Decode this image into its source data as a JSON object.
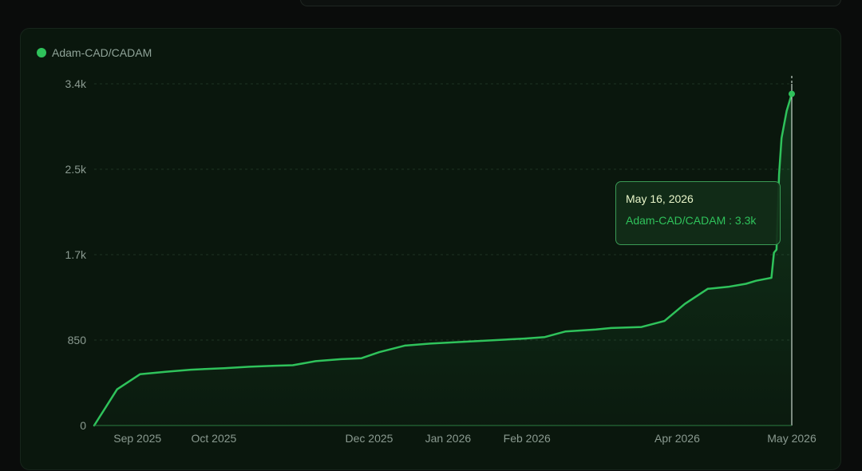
{
  "chart_data": {
    "type": "area",
    "series": [
      {
        "name": "Adam-CAD/CADAM",
        "color": "#2fc25b",
        "points": [
          {
            "x": "2025-08-15",
            "y": 0
          },
          {
            "x": "2025-08-24",
            "y": 360
          },
          {
            "x": "2025-09-02",
            "y": 510
          },
          {
            "x": "2025-09-12",
            "y": 535
          },
          {
            "x": "2025-09-22",
            "y": 555
          },
          {
            "x": "2025-10-05",
            "y": 570
          },
          {
            "x": "2025-10-15",
            "y": 585
          },
          {
            "x": "2025-10-25",
            "y": 595
          },
          {
            "x": "2025-11-01",
            "y": 600
          },
          {
            "x": "2025-11-10",
            "y": 640
          },
          {
            "x": "2025-11-20",
            "y": 660
          },
          {
            "x": "2025-11-28",
            "y": 670
          },
          {
            "x": "2025-12-05",
            "y": 730
          },
          {
            "x": "2025-12-15",
            "y": 795
          },
          {
            "x": "2025-12-25",
            "y": 815
          },
          {
            "x": "2026-01-05",
            "y": 830
          },
          {
            "x": "2026-01-20",
            "y": 850
          },
          {
            "x": "2026-01-31",
            "y": 865
          },
          {
            "x": "2026-02-08",
            "y": 880
          },
          {
            "x": "2026-02-16",
            "y": 935
          },
          {
            "x": "2026-02-28",
            "y": 955
          },
          {
            "x": "2026-03-06",
            "y": 970
          },
          {
            "x": "2026-03-18",
            "y": 980
          },
          {
            "x": "2026-03-27",
            "y": 1040
          },
          {
            "x": "2026-04-04",
            "y": 1210
          },
          {
            "x": "2026-04-13",
            "y": 1360
          },
          {
            "x": "2026-04-21",
            "y": 1380
          },
          {
            "x": "2026-04-28",
            "y": 1410
          },
          {
            "x": "2026-05-02",
            "y": 1440
          },
          {
            "x": "2026-05-06",
            "y": 1460
          },
          {
            "x": "2026-05-08",
            "y": 1470
          },
          {
            "x": "2026-05-09",
            "y": 1720
          },
          {
            "x": "2026-05-10",
            "y": 1750
          },
          {
            "x": "2026-05-11",
            "y": 2500
          },
          {
            "x": "2026-05-12",
            "y": 2860
          },
          {
            "x": "2026-05-14",
            "y": 3130
          },
          {
            "x": "2026-05-16",
            "y": 3300
          }
        ]
      }
    ],
    "x_ticks": [
      {
        "label": "Sep 2025",
        "x": "2025-09-01"
      },
      {
        "label": "Oct 2025",
        "x": "2025-10-01"
      },
      {
        "label": "Dec 2025",
        "x": "2025-12-01"
      },
      {
        "label": "Jan 2026",
        "x": "2026-01-01"
      },
      {
        "label": "Feb 2026",
        "x": "2026-02-01"
      },
      {
        "label": "Apr 2026",
        "x": "2026-04-01"
      },
      {
        "label": "May 2026",
        "x": "2026-05-16"
      }
    ],
    "y_ticks": [
      {
        "label": "0",
        "value": 0
      },
      {
        "label": "850",
        "value": 850
      },
      {
        "label": "1.7k",
        "value": 1700
      },
      {
        "label": "2.5k",
        "value": 2550
      },
      {
        "label": "3.4k",
        "value": 3400
      }
    ],
    "ylim": [
      0,
      3400
    ],
    "grid": true,
    "legend_position": "top-left"
  },
  "legend": {
    "label": "Adam-CAD/CADAM",
    "color": "#2fc25b"
  },
  "tooltip": {
    "date": "May 16, 2026",
    "label": "Adam-CAD/CADAM : 3.3k"
  }
}
